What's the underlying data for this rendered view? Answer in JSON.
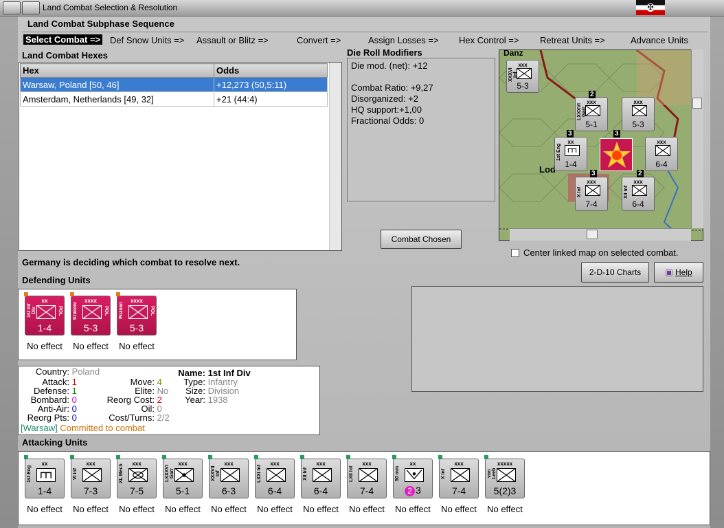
{
  "window": {
    "title": "Land Combat Selection & Resolution"
  },
  "phases": {
    "title": "Land Combat Subphase Sequence",
    "items": [
      "Select Combat =>",
      "Def Snow Units =>",
      "Assault or Blitz =>",
      "Convert =>",
      "Assign Losses =>",
      "Hex Control =>",
      "Retreat Units =>",
      "Advance Units"
    ]
  },
  "hexes": {
    "title": "Land Combat Hexes",
    "headers": [
      "Hex",
      "Odds"
    ],
    "rows": [
      {
        "hex": "Warsaw, Poland [50, 46]",
        "odds": "+12,273 (50,5:11)"
      },
      {
        "hex": "Amsterdam, Netherlands [49, 32]",
        "odds": "+21 (44:4)"
      }
    ]
  },
  "modifiers": {
    "title": "Die Roll Modifiers",
    "lines": [
      "Die mod. (net): +12",
      "",
      "Combat Ratio: +9,27",
      "Disorganized: +2",
      "HQ support:+1,00",
      "Fractional Odds: 0"
    ]
  },
  "buttons": {
    "combat_chosen": "Combat Chosen",
    "charts": "2-D-10 Charts",
    "help": "Help"
  },
  "center_map_label": "Center linked map on selected combat.",
  "status": "Germany is deciding which combat to resolve next.",
  "defending": {
    "title": "Defending Units",
    "units": [
      {
        "size": "xx",
        "name": "1st Inf Div",
        "country": "POL",
        "strength": "1-4",
        "effect": "No effect"
      },
      {
        "size": "xxxx",
        "name": "Krakow",
        "country": "POL",
        "strength": "5-3",
        "effect": "No effect"
      },
      {
        "size": "xxxx",
        "name": "Poznan",
        "country": "POL",
        "strength": "5-3",
        "effect": "No effect"
      }
    ]
  },
  "unit_info": {
    "country_lbl": "Country:",
    "country": "Poland",
    "attack_lbl": "Attack:",
    "attack": "1",
    "defense_lbl": "Defense:",
    "defense": "1",
    "bombard_lbl": "Bombard:",
    "bombard": "0",
    "antiair_lbl": "Anti-Air:",
    "antiair": "0",
    "reorg_pts_lbl": "Reorg Pts:",
    "reorg_pts": "0",
    "move_lbl": "Move:",
    "move": "4",
    "elite_lbl": "Elite:",
    "elite": "No",
    "reorg_cost_lbl": "Reorg Cost:",
    "reorg_cost": "2",
    "oil_lbl": "Oil:",
    "oil": "0",
    "cost_turns_lbl": "Cost/Turns:",
    "cost_turns": "2/2",
    "name_lbl": "Name:",
    "name": "1st Inf Div",
    "type_lbl": "Type:",
    "type": "Infantry",
    "size_lbl": "Size:",
    "size": "Division",
    "year_lbl": "Year:",
    "year": "1938",
    "location": "[Warsaw]",
    "committed": "Committed to combat"
  },
  "attacking": {
    "title": "Attacking Units",
    "units": [
      {
        "size": "xx",
        "name": "1st Eng",
        "strength": "1-4",
        "effect": "No effect",
        "sym": "eng"
      },
      {
        "size": "xxx",
        "name": "VI Inf",
        "strength": "7-3",
        "effect": "No effect",
        "sym": "inf"
      },
      {
        "size": "xxx",
        "name": "XL Mech",
        "strength": "7-5",
        "effect": "No effect",
        "sym": "mech"
      },
      {
        "size": "xxx",
        "name": "LXXXVI Garr",
        "strength": "5-1",
        "effect": "No effect",
        "sym": "garr"
      },
      {
        "size": "xxx",
        "name": "XXXVII Inf",
        "strength": "6-3",
        "effect": "No effect",
        "sym": "inf"
      },
      {
        "size": "xxx",
        "name": "LXXI Inf",
        "strength": "6-4",
        "effect": "No effect",
        "sym": "inf"
      },
      {
        "size": "xxx",
        "name": "XII Inf",
        "strength": "6-4",
        "effect": "No effect",
        "sym": "inf"
      },
      {
        "size": "xxx",
        "name": "LXII Inf",
        "strength": "7-4",
        "effect": "No effect",
        "sym": "inf"
      },
      {
        "size": "xx",
        "name": "50 mm",
        "strength": "3",
        "badge": "2",
        "effect": "No effect",
        "sym": "art"
      },
      {
        "size": "xxx",
        "name": "X Inf",
        "strength": "7-4",
        "effect": "No effect",
        "sym": "inf"
      },
      {
        "size": "xxxxx",
        "name": "von Leeb",
        "strength": "5(2)3",
        "effect": "No effect",
        "sym": "hq"
      }
    ]
  },
  "map": {
    "label_danzig": "Danz",
    "label_lodz": "Lod",
    "units": [
      {
        "size": "xxx",
        "name": "XXXVI Inf",
        "strength": "5-3"
      },
      {
        "size": "xxx",
        "name": "LXXXVI Garr",
        "strength": "5-1"
      },
      {
        "size": "xxx",
        "name": "",
        "strength": "5-3"
      },
      {
        "size": "xx",
        "name": "1st Eng",
        "strength": "1-4"
      },
      {
        "size": "xxx",
        "name": "",
        "strength": "6-4"
      },
      {
        "size": "xxx",
        "name": "X Inf",
        "strength": "7-4"
      },
      {
        "size": "xxx",
        "name": "XII Inf",
        "strength": "6-4"
      }
    ],
    "stack_counts": [
      "2",
      "3",
      "3",
      "3",
      "2"
    ]
  }
}
